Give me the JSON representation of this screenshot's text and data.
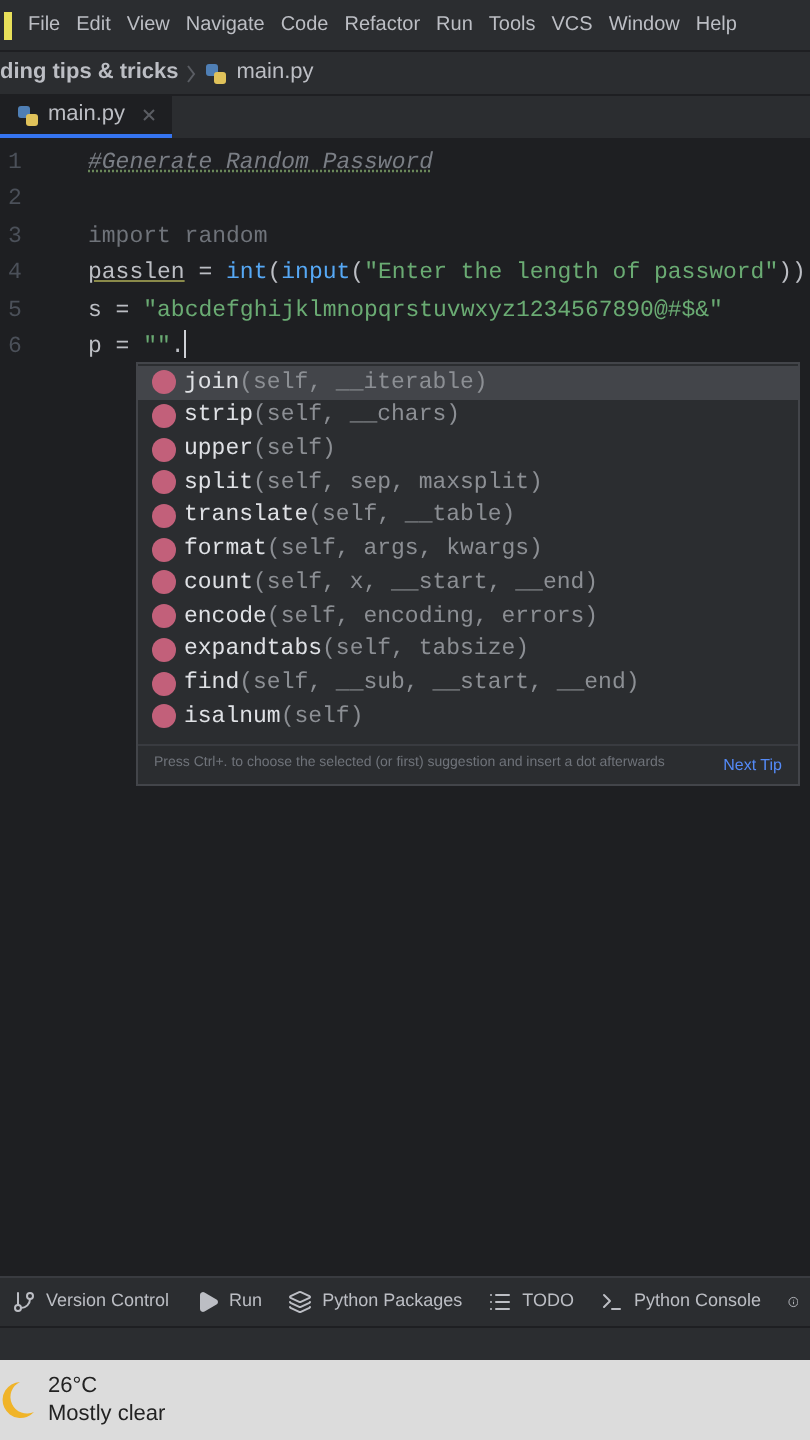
{
  "menu_bar": [
    "File",
    "Edit",
    "View",
    "Navigate",
    "Code",
    "Refactor",
    "Run",
    "Tools",
    "VCS",
    "Window",
    "Help"
  ],
  "breadcrumb": [
    "ding tips & tricks",
    "main.py"
  ],
  "tabs": [
    {
      "label": "main.py",
      "selected": true
    }
  ],
  "editor": {
    "lines": [
      {
        "number": "1",
        "tokens": [
          {
            "kind": "comment",
            "text": "#Generate Random Password"
          }
        ]
      },
      {
        "number": "2"
      },
      {
        "number": "3",
        "tokens": [
          {
            "kind": "unused",
            "text": "import random"
          }
        ]
      },
      {
        "number": "4",
        "tokens": [
          {
            "kind": "underlined",
            "text": "passlen"
          },
          {
            "kind": "plain",
            "text": " = "
          },
          {
            "kind": "builtin",
            "text": "int"
          },
          {
            "kind": "plain",
            "text": "("
          },
          {
            "kind": "builtin",
            "text": "input"
          },
          {
            "kind": "plain",
            "text": "("
          },
          {
            "kind": "string",
            "text": "\"Enter the length of password\""
          },
          {
            "kind": "plain",
            "text": "))"
          }
        ]
      },
      {
        "number": "5",
        "tokens": [
          {
            "kind": "plain",
            "text": "s = "
          },
          {
            "kind": "string",
            "text": "\"abcdefghijklmnopqrstuvwxyz1234567890@#$&\""
          }
        ]
      },
      {
        "number": "6",
        "tokens": [
          {
            "kind": "plain",
            "text": "p = "
          },
          {
            "kind": "string",
            "text": "\"\""
          },
          {
            "kind": "plain",
            "text": "."
          },
          {
            "kind": "cursor"
          }
        ]
      }
    ]
  },
  "completion": {
    "items": [
      {
        "name": "join",
        "params": "(self, __iterable)",
        "selected": true
      },
      {
        "name": "strip",
        "params": "(self, __chars)",
        "selected": false
      },
      {
        "name": "upper",
        "params": "(self)",
        "selected": false
      },
      {
        "name": "split",
        "params": "(self, sep, maxsplit)",
        "selected": false
      },
      {
        "name": "translate",
        "params": "(self, __table)",
        "selected": false
      },
      {
        "name": "format",
        "params": "(self, args, kwargs)",
        "selected": false
      },
      {
        "name": "count",
        "params": "(self, x, __start, __end)",
        "selected": false
      },
      {
        "name": "encode",
        "params": "(self, encoding, errors)",
        "selected": false
      },
      {
        "name": "expandtabs",
        "params": "(self, tabsize)",
        "selected": false
      },
      {
        "name": "find",
        "params": "(self, __sub, __start, __end)",
        "selected": false
      },
      {
        "name": "isalnum",
        "params": "(self)",
        "selected": false
      }
    ],
    "hint": "Press Ctrl+. to choose the selected (or first) suggestion and insert a dot afterwards",
    "hint_link": "Next Tip"
  },
  "tool_bar": [
    {
      "kind": "vcs",
      "label": "Version Control"
    },
    {
      "kind": "run",
      "label": "Run"
    },
    {
      "kind": "packages",
      "label": "Python Packages"
    },
    {
      "kind": "todo",
      "label": "TODO"
    },
    {
      "kind": "console",
      "label": "Python Console"
    }
  ],
  "taskbar": {
    "temperature": "26°C",
    "weather": "Mostly clear"
  }
}
